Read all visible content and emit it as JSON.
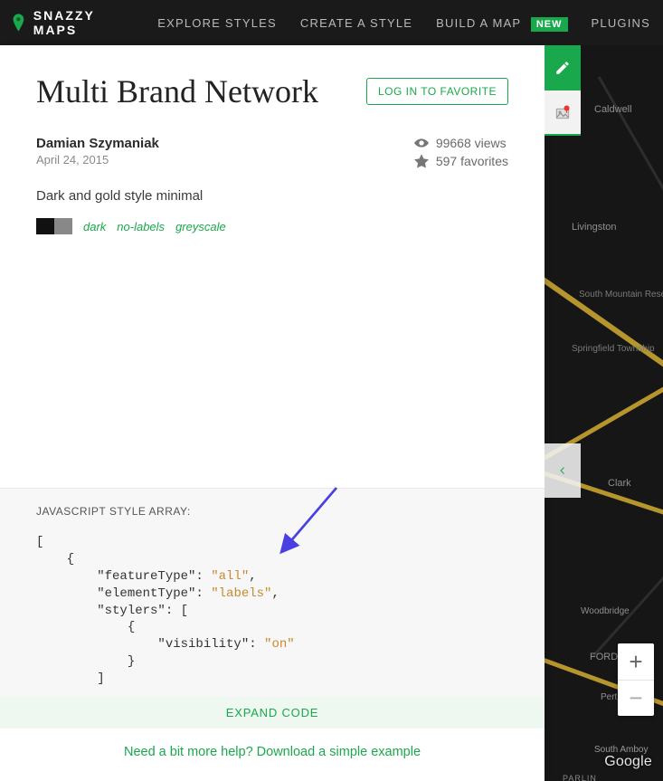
{
  "brand": "SNAZZY MAPS",
  "nav": {
    "explore": "EXPLORE STYLES",
    "create": "CREATE A STYLE",
    "build": "BUILD A MAP",
    "build_badge": "NEW",
    "plugins": "PLUGINS"
  },
  "style": {
    "title": "Multi Brand Network",
    "favorite_btn": "LOG IN TO FAVORITE",
    "author": "Damian Szymaniak",
    "date": "April 24, 2015",
    "views": "99668 views",
    "favorites": "597 favorites",
    "description": "Dark and gold style minimal",
    "tags": [
      "dark",
      "no-labels",
      "greyscale"
    ],
    "swatches": [
      "#111111",
      "#888888"
    ]
  },
  "code": {
    "label": "JAVASCRIPT STYLE ARRAY:",
    "l1": "[",
    "l2": "    {",
    "l3a": "        \"featureType\": ",
    "l3b": "\"all\"",
    "l3c": ",",
    "l4a": "        \"elementType\": ",
    "l4b": "\"labels\"",
    "l4c": ",",
    "l5": "        \"stylers\": [",
    "l6": "            {",
    "l7a": "                \"visibility\": ",
    "l7b": "\"on\"",
    "l8": "            }",
    "l9": "        ]",
    "expand": "EXPAND CODE",
    "help": "Need a bit more help? Download a simple example"
  },
  "map": {
    "labels": {
      "caldwell": "Caldwell",
      "livingston": "Livingston",
      "south_mtn": "South Mountain Reservation",
      "springfield": "Springfield Township",
      "clark": "Clark",
      "woodbridge": "Woodbridge",
      "fords": "FORDS",
      "perth": "Perth A",
      "samboy": "South Amboy",
      "parlin": "PARLIN"
    },
    "google": "Google",
    "zoom_in": "+",
    "zoom_out": "−"
  }
}
